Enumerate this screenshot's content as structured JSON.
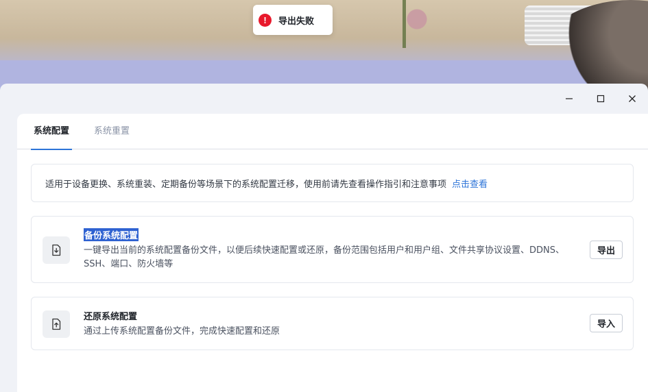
{
  "toast": {
    "icon": "error-icon",
    "text": "导出失败",
    "color": "#e8192c"
  },
  "window_controls": [
    "minimize-icon",
    "maximize-icon",
    "close-icon"
  ],
  "tabs": [
    {
      "label": "系统配置",
      "active": true
    },
    {
      "label": "系统重置",
      "active": false
    }
  ],
  "notice": {
    "text": "适用于设备更换、系统重装、定期备份等场景下的系统配置迁移，使用前请先查看操作指引和注意事项",
    "link": "点击查看"
  },
  "backup": {
    "icon": "file-download-icon",
    "title": "备份系统配置",
    "description": "一键导出当前的系统配置备份文件，以便后续快速配置或还原，备份范围包括用户和用户组、文件共享协议设置、DDNS、SSH、端口、防火墙等",
    "button": "导出"
  },
  "restore": {
    "icon": "file-upload-icon",
    "title": "还原系统配置",
    "description": "通过上传系统配置备份文件，完成快速配置和还原",
    "button": "导入"
  },
  "accent_color": "#2d74d8"
}
